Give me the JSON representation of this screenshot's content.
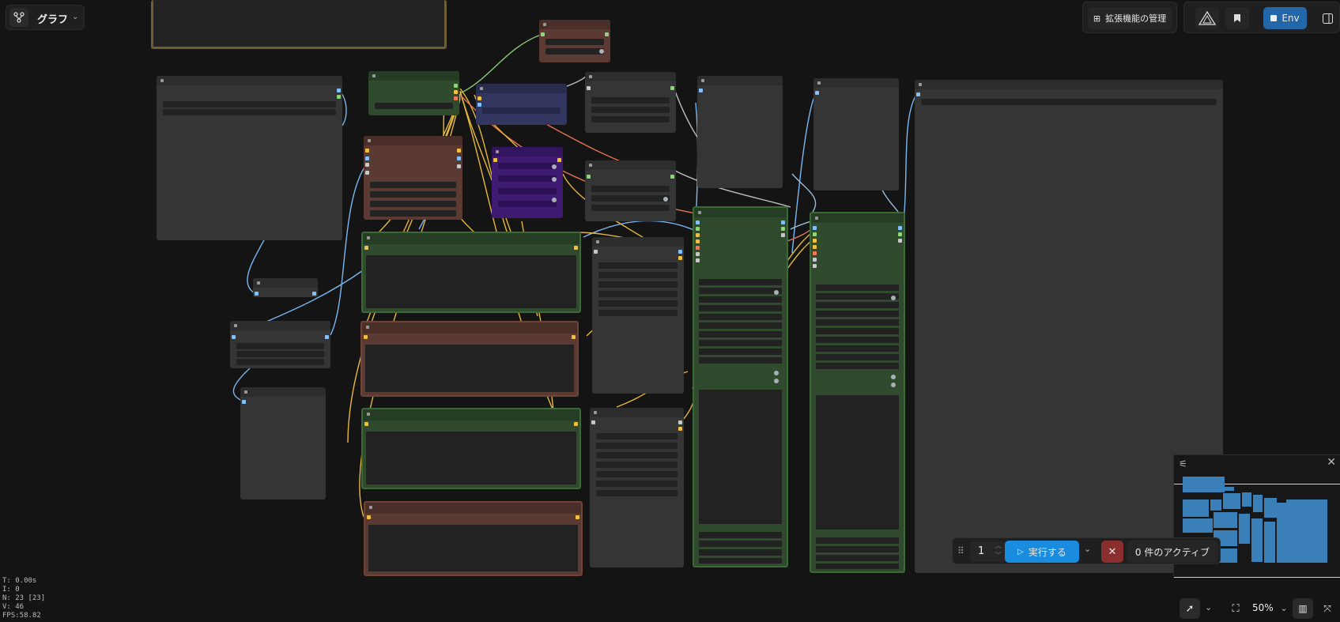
{
  "header": {
    "workflow_label": "グラフ",
    "extensions_button": "拡張機能の管理",
    "env_button": "Env"
  },
  "run_toolbar": {
    "batch_count": "1",
    "run_label": "実行する",
    "queue_status": "0 件のアクティブ"
  },
  "zoom": {
    "level": "50%"
  },
  "stats": {
    "time": "T: 0.00s",
    "i": "I: 0",
    "nodes": "N: 23 [23]",
    "v": "V: 46",
    "fps": "FPS:58.82"
  },
  "colors": {
    "accent_run": "#1a8ce0",
    "env_button": "#2467a8",
    "cancel_button": "#8a2e2e",
    "node_green": "#2f4a2d",
    "node_brown": "#5a3a32",
    "node_purple": "#3e1a73",
    "node_navy": "#33365e",
    "node_gray": "#353535",
    "minimap_blue": "#3b7fb8"
  },
  "icons": [
    "workflow-icon",
    "chevron-down-icon",
    "extensions-icon",
    "logo-icon",
    "bookmark-icon",
    "panel-toggle-icon",
    "drag-handle-icon",
    "play-icon",
    "close-icon",
    "settings-sliders-icon",
    "pointer-icon",
    "fit-view-icon",
    "minimap-icon",
    "link-visibility-icon"
  ]
}
